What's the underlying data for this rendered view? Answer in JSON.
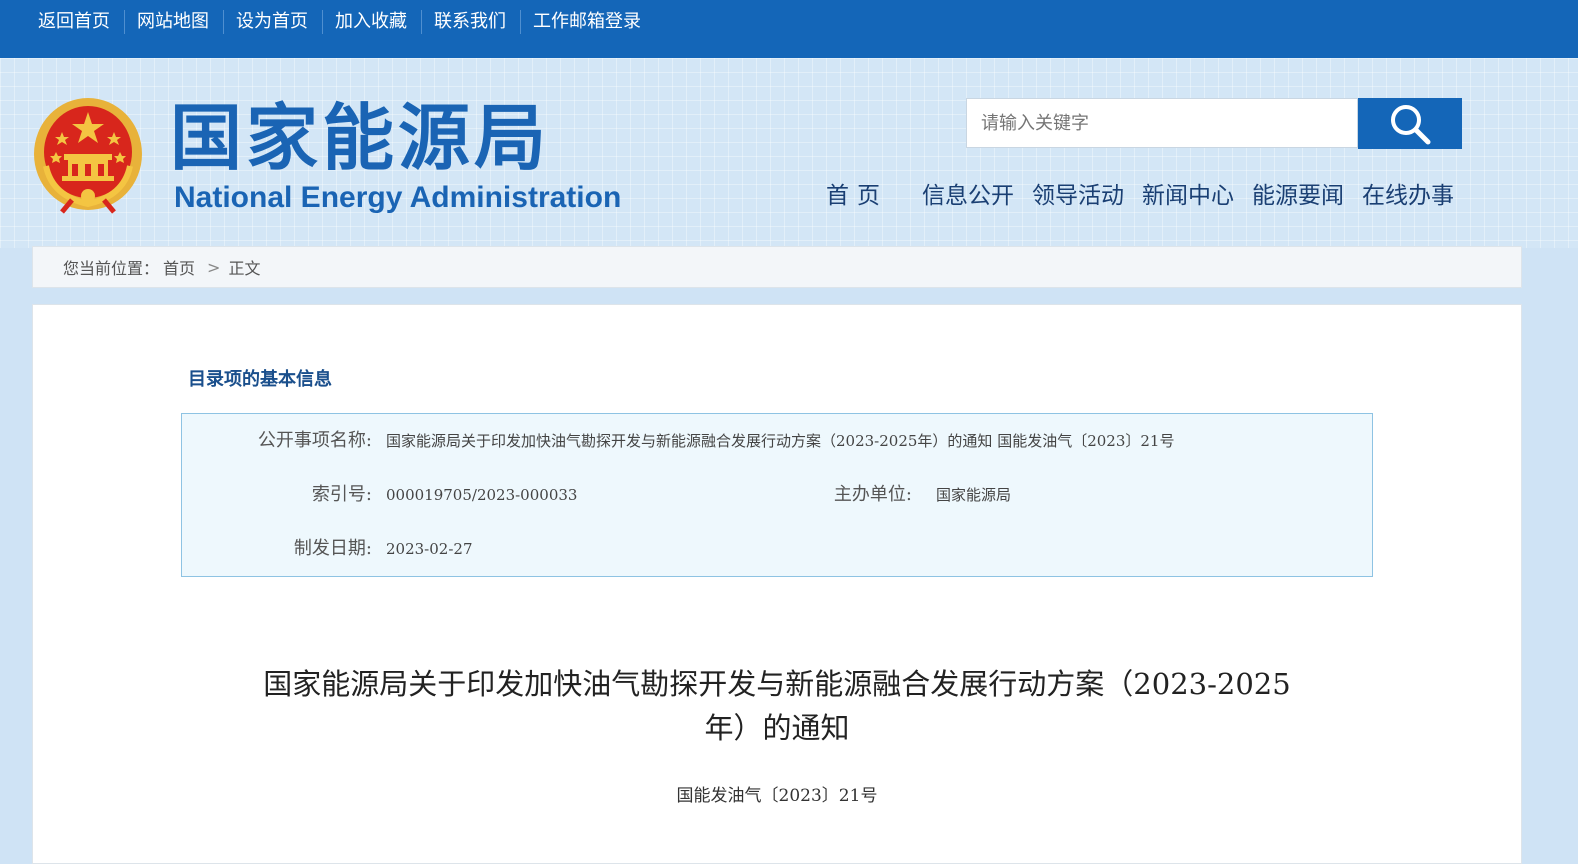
{
  "topbar": {
    "links": [
      "返回首页",
      "网站地图",
      "设为首页",
      "加入收藏",
      "联系我们",
      "工作邮箱登录"
    ]
  },
  "header": {
    "logo_cn": "国家能源局",
    "logo_en": "National Energy Administration",
    "search": {
      "placeholder": "请输入关键字"
    },
    "nav": [
      "首页",
      "信息公开",
      "领导活动",
      "新闻中心",
      "能源要闻",
      "在线办事"
    ]
  },
  "breadcrumb": {
    "prefix": "您当前位置：",
    "items": [
      "首页",
      "正文"
    ],
    "separator": ">"
  },
  "info": {
    "section_title": "目录项的基本信息",
    "name_label": "公开事项名称:",
    "name_value": "国家能源局关于印发加快油气勘探开发与新能源融合发展行动方案（2023-2025年）的通知 国能发油气〔2023〕21号",
    "index_label": "索引号:",
    "index_value": "000019705/2023-000033",
    "org_label": "主办单位:",
    "org_value": "国家能源局",
    "date_label": "制发日期:",
    "date_value": "2023-02-27"
  },
  "document": {
    "title_line1": "国家能源局关于印发加快油气勘探开发与新能源融合发展行动方案（2023-2025",
    "title_line2": "年）的通知",
    "number": "国能发油气〔2023〕21号"
  },
  "colors": {
    "brand_blue": "#1466b8",
    "logo_blue": "#1a64b4",
    "info_bg": "#eef8fd",
    "info_border": "#8ec3e3"
  }
}
